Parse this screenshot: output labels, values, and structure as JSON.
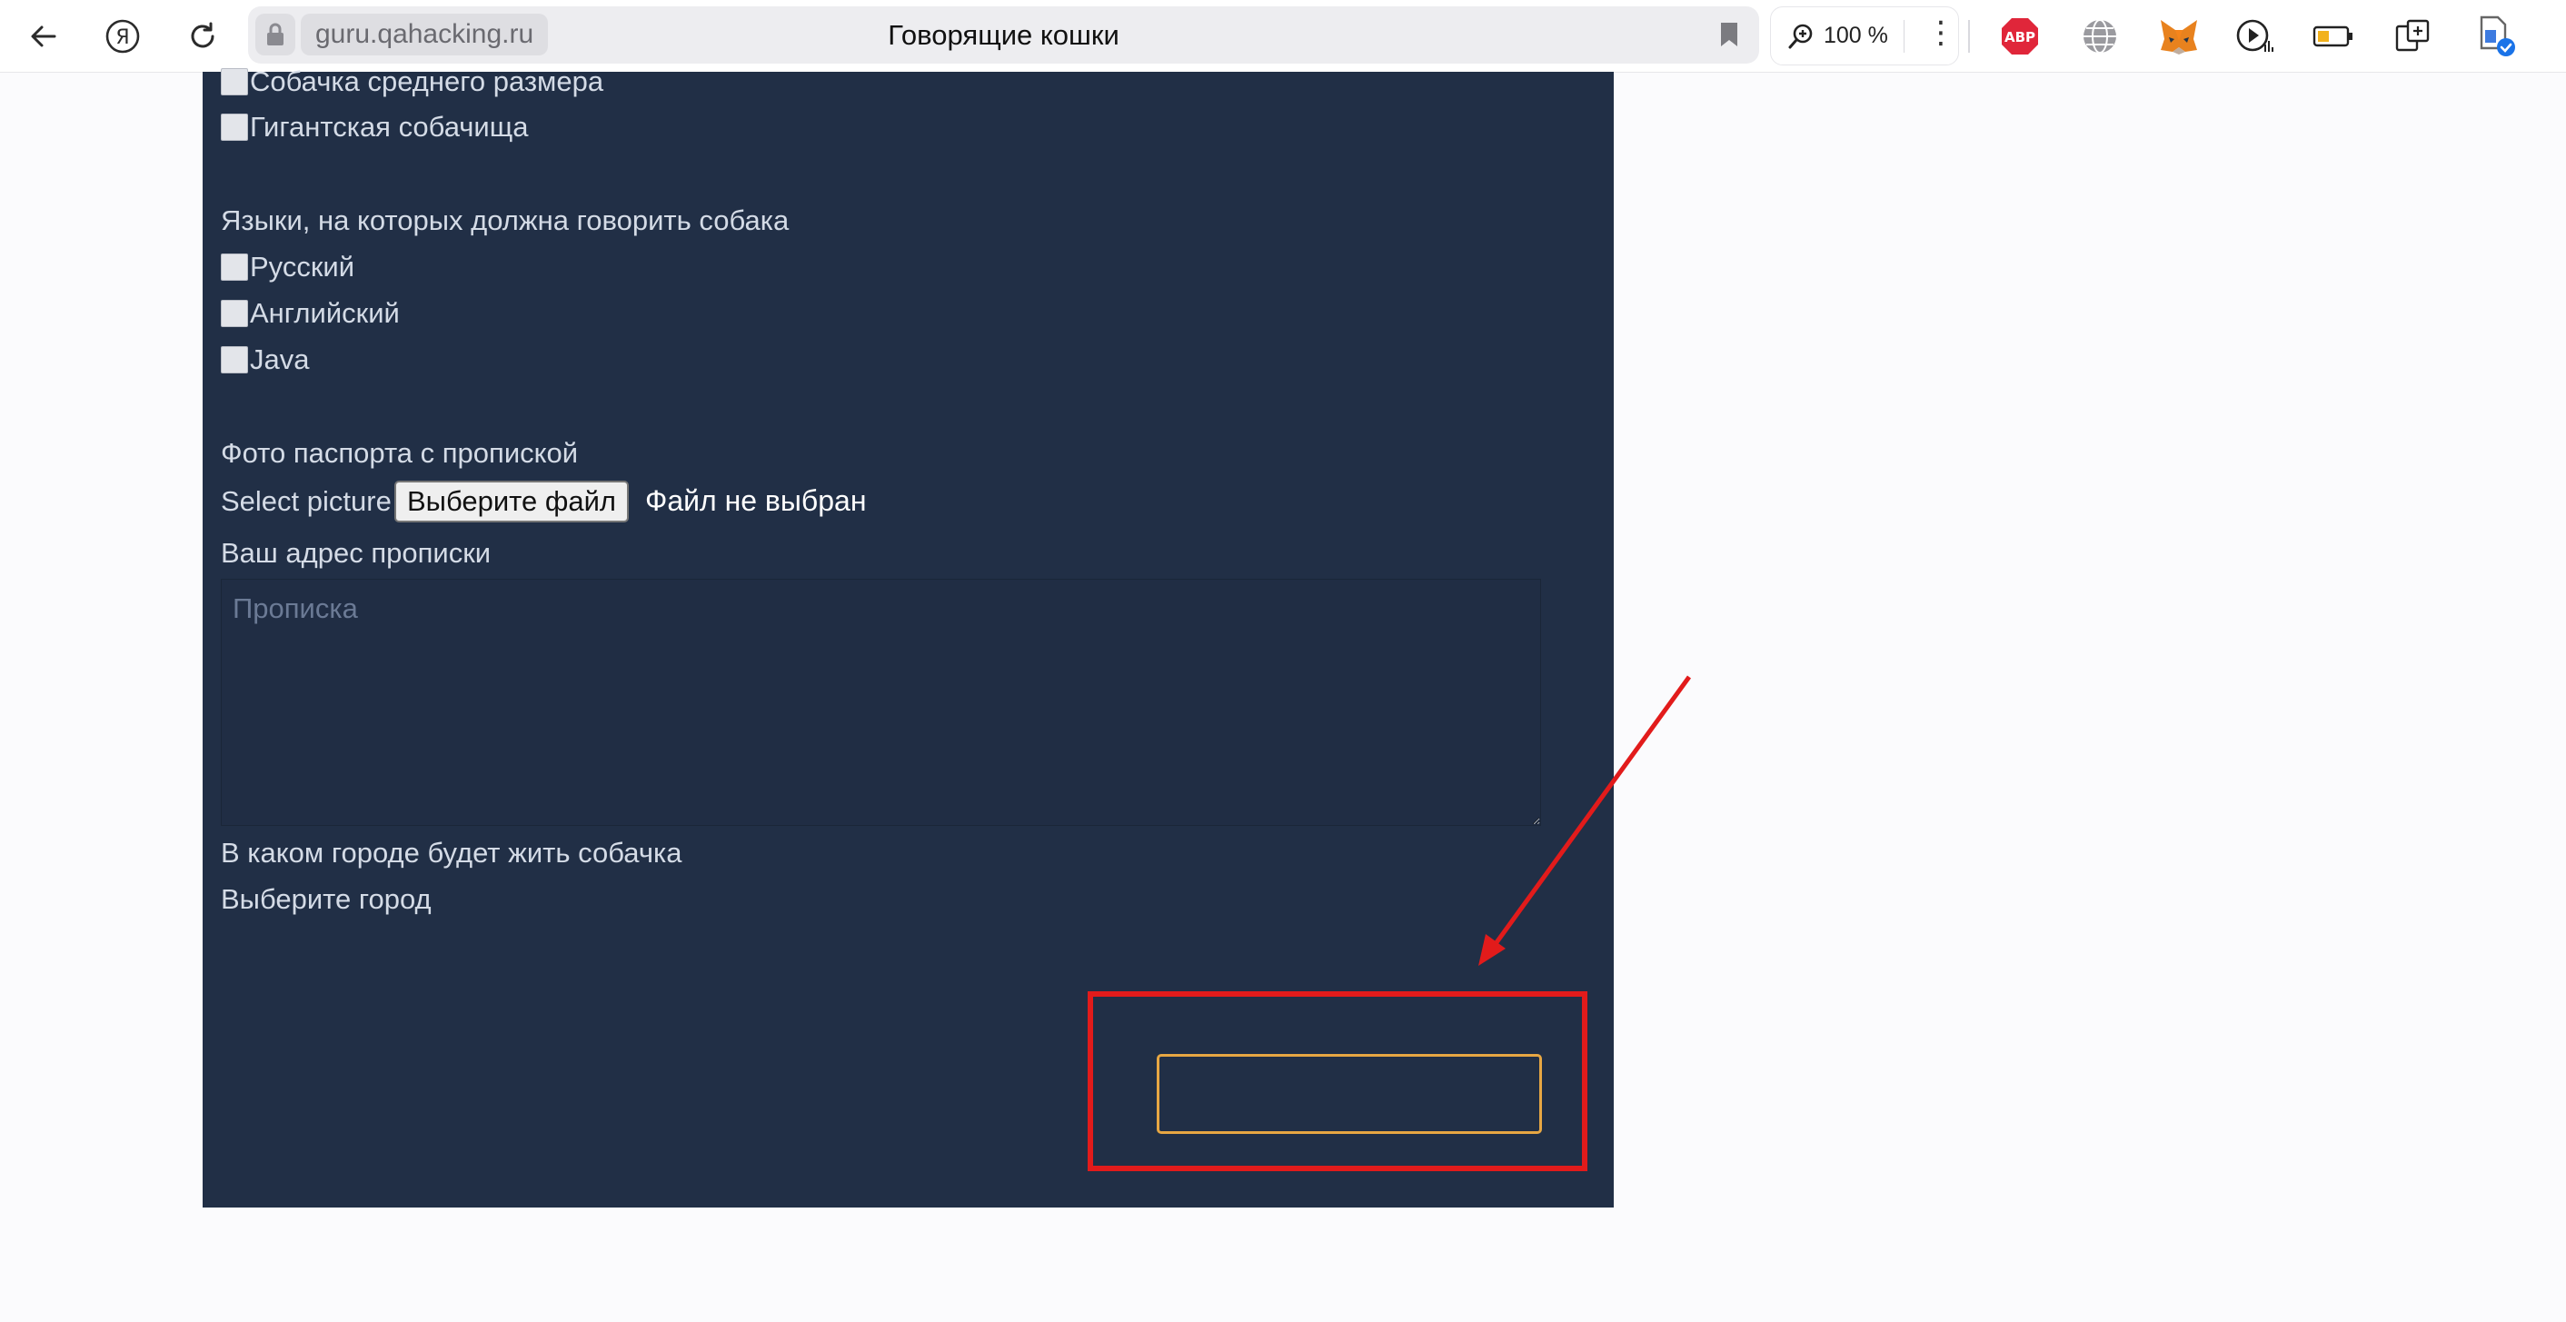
{
  "browser": {
    "url_domain": "guru.qahacking.ru",
    "page_title": "Говорящие кошки",
    "zoom": "100 %",
    "extensions": [
      "adblock-plus-icon",
      "globe-translate-icon",
      "metamask-fox-icon",
      "media-play-icon",
      "battery-icon",
      "screenshot-icon",
      "document-check-icon"
    ]
  },
  "form": {
    "size_options": [
      "Собачка среднего размера",
      "Гигантская собачища"
    ],
    "languages_label": "Языки, на которых должна говорить собака",
    "language_options": [
      "Русский",
      "Английский",
      "Java"
    ],
    "passport_label": "Фото паспорта с пропиской",
    "select_picture_label": "Select picture",
    "file_button_label": "Выберите файл",
    "file_status": "Файл не выбран",
    "address_label": "Ваш адрес прописки",
    "address_placeholder": "Прописка",
    "city_question": "В каком городе будет жить собачка",
    "city_select_label": "Выберите город",
    "submit_label": ""
  },
  "annotation": {
    "highlight_color": "#e21b1b",
    "button_border_color": "#e7a743",
    "panel_color": "#212f46"
  }
}
